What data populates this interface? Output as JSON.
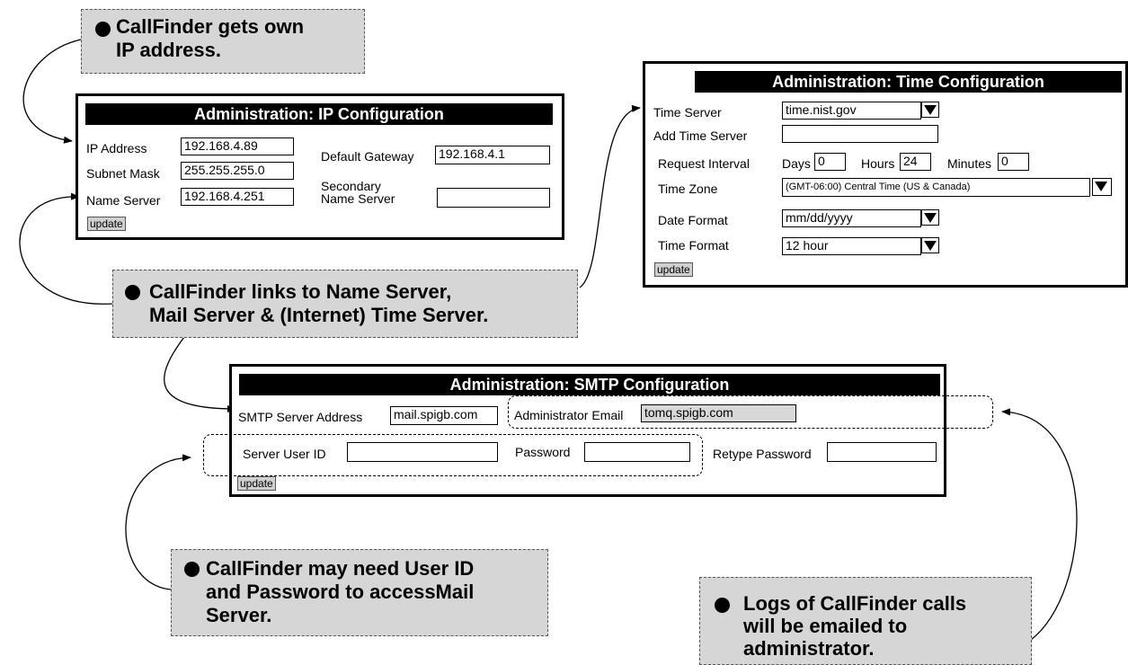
{
  "callouts": {
    "ip_address": {
      "line1": "CallFinder gets own",
      "line2": "IP address."
    },
    "links": {
      "line1": "CallFinder links to Name Server,",
      "line2": "Mail Server & (Internet) Time Server."
    },
    "userid": {
      "line1": "CallFinder may need User ID",
      "line2": "and Password to accessMail",
      "line3": "Server."
    },
    "logs": {
      "line1": "Logs of CallFinder calls",
      "line2": "will be emailed to",
      "line3": "administrator."
    }
  },
  "ip_config": {
    "title": "Administration: IP Configuration",
    "ip_address_label": "IP Address",
    "ip_address_value": "192.168.4.89",
    "subnet_mask_label": "Subnet Mask",
    "subnet_mask_value": "255.255.255.0",
    "name_server_label": "Name Server",
    "name_server_value": "192.168.4.251",
    "default_gateway_label": "Default Gateway",
    "default_gateway_value": "192.168.4.1",
    "secondary_label_1": "Secondary",
    "secondary_label_2": "Name Server",
    "secondary_value": "",
    "update_label": "update"
  },
  "time_config": {
    "title": "Administration: Time Configuration",
    "time_server_label": "Time Server",
    "time_server_value": "time.nist.gov",
    "add_time_server_label": "Add Time Server",
    "add_time_server_value": "",
    "request_interval_label": "Request Interval",
    "days_label": "Days",
    "days_value": "0",
    "hours_label": "Hours",
    "hours_value": "24",
    "minutes_label": "Minutes",
    "minutes_value": "0",
    "time_zone_label": "Time Zone",
    "time_zone_value": "(GMT-06:00) Central Time (US & Canada)",
    "date_format_label": "Date Format",
    "date_format_value": "mm/dd/yyyy",
    "time_format_label": "Time Format",
    "time_format_value": "12 hour",
    "update_label": "update"
  },
  "smtp_config": {
    "title": "Administration: SMTP Configuration",
    "smtp_server_label": "SMTP Server  Address",
    "smtp_server_value": "mail.spigb.com",
    "admin_email_label": "Administrator Email",
    "admin_email_value": "tomq.spigb.com",
    "user_id_label": "Server  User ID",
    "user_id_value": "",
    "password_label": "Password",
    "password_value": "",
    "retype_label": "Retype Password",
    "retype_value": "",
    "update_label": "update"
  }
}
